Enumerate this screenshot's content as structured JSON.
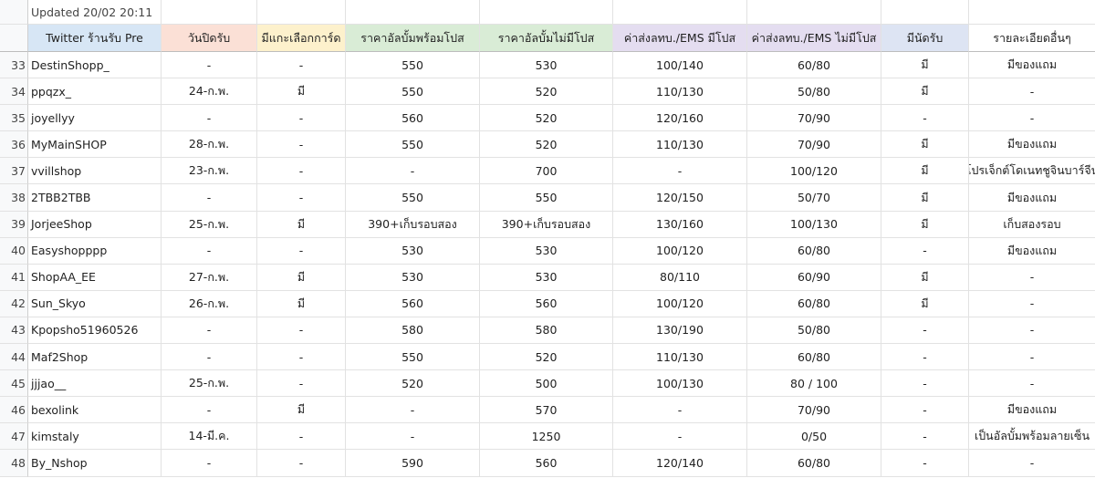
{
  "updated_text": "Updated 20/02 20:11",
  "headers": [
    {
      "label": "Twitter ร้านรับ Pre",
      "bg": "#d7e6f5"
    },
    {
      "label": "วันปิดรับ",
      "bg": "#fbe0d6"
    },
    {
      "label": "มีแกะเลือกการ์ด",
      "bg": "#fdf1cc"
    },
    {
      "label": "ราคาอัลบั้มพร้อมโปส",
      "bg": "#d9ecd6"
    },
    {
      "label": "ราคาอัลบั้มไม่มีโปส",
      "bg": "#d9ecd6"
    },
    {
      "label": "ค่าส่งลทบ./EMS มีโปส",
      "bg": "#e4ddf0"
    },
    {
      "label": "ค่าส่งลทบ./EMS ไม่มีโปส",
      "bg": "#e4ddf0"
    },
    {
      "label": "มีนัดรับ",
      "bg": "#dde4f3"
    },
    {
      "label": "รายละเอียดอื่นๆ",
      "bg": "#ffffff"
    }
  ],
  "rows": [
    {
      "num": "33",
      "cells": [
        "DestinShopp_",
        "-",
        "-",
        "550",
        "530",
        "100/140",
        "60/80",
        "มี",
        "มีของแถม"
      ]
    },
    {
      "num": "34",
      "cells": [
        "ppqzx_",
        "24-ก.พ.",
        "มี",
        "550",
        "520",
        "110/130",
        "50/80",
        "มี",
        "-"
      ]
    },
    {
      "num": "35",
      "cells": [
        "joyellyy",
        "-",
        "-",
        "560",
        "520",
        "120/160",
        "70/90",
        "-",
        "-"
      ]
    },
    {
      "num": "36",
      "cells": [
        "MyMainSHOP",
        "28-ก.พ.",
        "-",
        "550",
        "520",
        "110/130",
        "70/90",
        "มี",
        "มีของแถม"
      ]
    },
    {
      "num": "37",
      "cells": [
        "vvillshop",
        "23-ก.พ.",
        "-",
        "-",
        "700",
        "-",
        "100/120",
        "มี",
        "โปรเจ็กต์โดเนทชูจินบาร์จีน"
      ]
    },
    {
      "num": "38",
      "cells": [
        "2TBB2TBB",
        "-",
        "-",
        "550",
        "550",
        "120/150",
        "50/70",
        "มี",
        "มีของแถม"
      ]
    },
    {
      "num": "39",
      "cells": [
        "JorjeeShop",
        "25-ก.พ.",
        "มี",
        "390+เก็บรอบสอง",
        "390+เก็บรอบสอง",
        "130/160",
        "100/130",
        "มี",
        "เก็บสองรอบ"
      ]
    },
    {
      "num": "40",
      "cells": [
        "Easyshopppp",
        "-",
        "-",
        "530",
        "530",
        "100/120",
        "60/80",
        "-",
        "มีของแถม"
      ]
    },
    {
      "num": "41",
      "cells": [
        "ShopAA_EE",
        "27-ก.พ.",
        "มี",
        "530",
        "530",
        "80/110",
        "60/90",
        "มี",
        "-"
      ]
    },
    {
      "num": "42",
      "cells": [
        "Sun_Skyo",
        "26-ก.พ.",
        "มี",
        "560",
        "560",
        "100/120",
        "60/80",
        "มี",
        "-"
      ]
    },
    {
      "num": "43",
      "cells": [
        "Kpopsho51960526",
        "-",
        "-",
        "580",
        "580",
        "130/190",
        "50/80",
        "-",
        "-"
      ]
    },
    {
      "num": "44",
      "cells": [
        "Maf2Shop",
        "-",
        "-",
        "550",
        "520",
        "110/130",
        "60/80",
        "-",
        "-"
      ]
    },
    {
      "num": "45",
      "cells": [
        "jjjao__",
        "25-ก.พ.",
        "-",
        "520",
        "500",
        "100/130",
        "80 / 100",
        "-",
        "-"
      ]
    },
    {
      "num": "46",
      "cells": [
        "bexolink",
        "-",
        "มี",
        "-",
        "570",
        "-",
        "70/90",
        "-",
        "มีของแถม"
      ]
    },
    {
      "num": "47",
      "cells": [
        "kimstaly",
        "14-มี.ค.",
        "-",
        "-",
        "1250",
        "-",
        "0/50",
        "-",
        "เป็นอัลบั้มพร้อมลายเซ็น"
      ]
    },
    {
      "num": "48",
      "cells": [
        "By_Nshop",
        "-",
        "-",
        "590",
        "560",
        "120/140",
        "60/80",
        "-",
        "-"
      ]
    }
  ]
}
